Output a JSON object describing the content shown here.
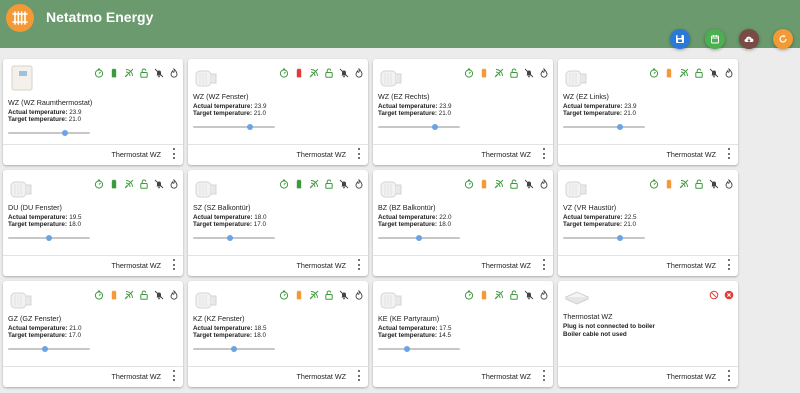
{
  "app": {
    "title": "Netatmo Energy"
  },
  "toolbar": [
    {
      "name": "save-button",
      "icon": "save-icon",
      "color": "#2b79d7"
    },
    {
      "name": "calendar-button",
      "icon": "calendar-icon",
      "color": "#4caf50"
    },
    {
      "name": "cloud-download-button",
      "icon": "cloud-download-icon",
      "color": "#7a4a44"
    },
    {
      "name": "refresh-button",
      "icon": "refresh-icon",
      "color": "#f39a36"
    }
  ],
  "labels": {
    "actual": "Actual temperature:",
    "target": "Target temperature:"
  },
  "valves": [
    {
      "name": "WZ (WZ Raumthermostat)",
      "device": "thermostat",
      "actual": "23.9",
      "target": "21.0",
      "level": 0.7,
      "battery": "green",
      "footer": "Thermostat WZ"
    },
    {
      "name": "WZ (WZ Fenster)",
      "device": "valve",
      "actual": "23.9",
      "target": "21.0",
      "level": 0.7,
      "battery": "red",
      "footer": "Thermostat WZ"
    },
    {
      "name": "WZ (EZ Rechts)",
      "device": "valve",
      "actual": "23.9",
      "target": "21.0",
      "level": 0.7,
      "battery": "orange",
      "footer": "Thermostat WZ"
    },
    {
      "name": "WZ (EZ Links)",
      "device": "valve",
      "actual": "23.9",
      "target": "21.0",
      "level": 0.7,
      "battery": "orange",
      "footer": "Thermostat WZ"
    },
    {
      "name": "DU (DU Fenster)",
      "device": "valve",
      "actual": "19.5",
      "target": "18.0",
      "level": 0.5,
      "battery": "green",
      "footer": "Thermostat WZ"
    },
    {
      "name": "SZ (SZ Balkontür)",
      "device": "valve",
      "actual": "18.0",
      "target": "17.0",
      "level": 0.45,
      "battery": "green",
      "footer": "Thermostat WZ"
    },
    {
      "name": "BZ (BZ Balkontür)",
      "device": "valve",
      "actual": "22.0",
      "target": "18.0",
      "level": 0.5,
      "battery": "orange",
      "footer": "Thermostat WZ"
    },
    {
      "name": "VZ (VR Haustür)",
      "device": "valve",
      "actual": "22.5",
      "target": "21.0",
      "level": 0.7,
      "battery": "orange",
      "footer": "Thermostat WZ"
    },
    {
      "name": "GZ (GZ Fenster)",
      "device": "valve",
      "actual": "21.0",
      "target": "17.0",
      "level": 0.45,
      "battery": "orange",
      "footer": "Thermostat WZ"
    },
    {
      "name": "KZ (KZ Fenster)",
      "device": "valve",
      "actual": "18.5",
      "target": "18.0",
      "level": 0.5,
      "battery": "orange",
      "footer": "Thermostat WZ"
    },
    {
      "name": "KE (KE Partyraum)",
      "device": "valve",
      "actual": "17.5",
      "target": "14.5",
      "level": 0.35,
      "battery": "orange",
      "footer": "Thermostat WZ"
    }
  ],
  "plug": {
    "name": "Thermostat WZ",
    "messages": [
      "Plug is not connected to boiler",
      "Boiler cable not used"
    ],
    "footer": "Thermostat WZ"
  },
  "colors": {
    "header": "#6a9a6d",
    "icon_green": "#3c9a3c",
    "battery_orange": "#f39a36",
    "battery_red": "#e53935",
    "slider_knob": "#6aa4e6"
  }
}
